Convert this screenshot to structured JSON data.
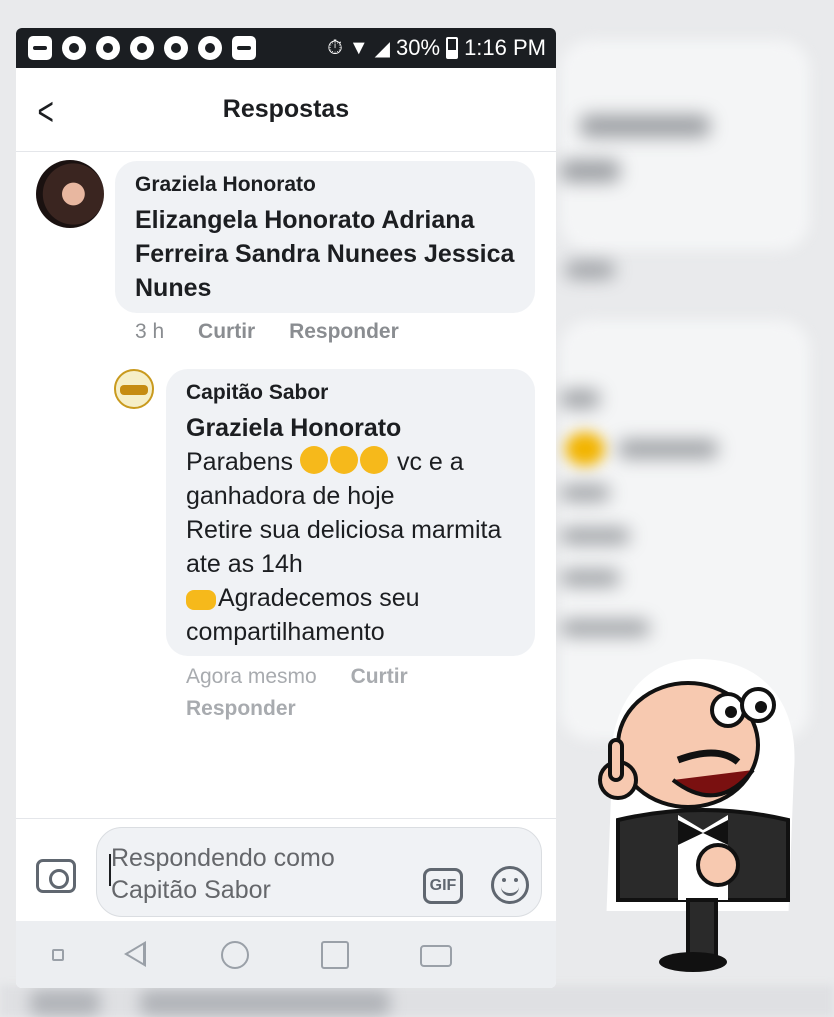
{
  "status_bar": {
    "battery": "30%",
    "time": "1:16 PM"
  },
  "header": {
    "title": "Respostas"
  },
  "comments": [
    {
      "author": "Graziela Honorato",
      "text_bold": "Elizangela Honorato Adriana Ferreira Sandra Nunees Jessica Nunes",
      "time": "3 h",
      "like": "Curtir",
      "reply": "Responder"
    },
    {
      "author": "Capitão Sabor",
      "mention": "Graziela Honorato",
      "line1": "Parabens",
      "line1_end": "vc e a ganhadora de hoje",
      "line2": "Retire sua deliciosa marmita ate as 14h",
      "line3": "Agradecemos seu compartilhamento",
      "time": "Agora mesmo",
      "like": "Curtir",
      "reply": "Responder"
    }
  ],
  "composer": {
    "placeholder": "Respondendo como Capitão Sabor",
    "gif_label": "GIF"
  },
  "icons": {
    "back": "chevron-left-icon",
    "camera": "camera-icon",
    "gif": "gif-icon",
    "emoji": "smiley-icon",
    "clap": "clapping-hands-emoji",
    "point": "pointing-right-emoji"
  },
  "colors": {
    "bubble": "#f0f2f5",
    "meta": "#8a8d91",
    "statusbar": "#1b1e22"
  }
}
